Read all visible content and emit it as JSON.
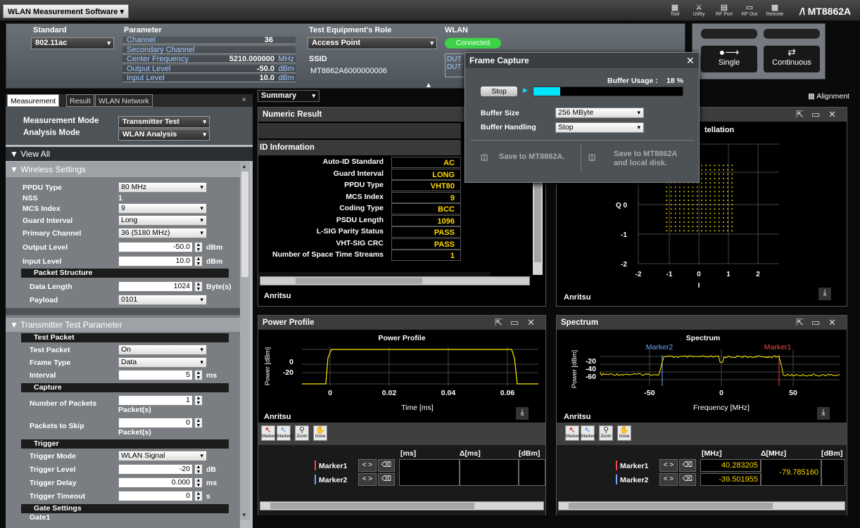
{
  "app": {
    "title": "WLAN Measurement Software",
    "toolbar": [
      {
        "label": "Tool",
        "icon": "tool-icon"
      },
      {
        "label": "Utility",
        "icon": "utility-icon"
      },
      {
        "label": "RF Port",
        "icon": "rf-port-icon"
      },
      {
        "label": "RF Out",
        "icon": "rf-out-icon"
      },
      {
        "label": "Remote",
        "icon": "remote-icon"
      }
    ],
    "brand": "MT8862A"
  },
  "params": {
    "standard_label": "Standard",
    "standard_value": "802.11ac",
    "parameter_label": "Parameter",
    "channel_label": "Channel",
    "channel_value": "36",
    "secondary_channel_label": "Secondary Channel",
    "center_freq_label": "Center Frequency",
    "center_freq_value": "5210.000000",
    "center_freq_unit": "MHz",
    "output_level_label": "Output Level",
    "output_level_value": "-50.0",
    "output_level_unit": "dBm",
    "input_level_label": "Input Level",
    "input_level_value": "10.0",
    "input_level_unit": "dBm",
    "role_label": "Test Equipment's Role",
    "role_value": "Access Point",
    "ssid_label": "SSID",
    "ssid_value": "MT8862A6000000006",
    "wlan_label": "WLAN",
    "wlan_status": "Connected",
    "dut_label_1": "DUT",
    "dut_label_2": "DUT"
  },
  "buttons": {
    "single": "Single",
    "continuous": "Continuous"
  },
  "alignment": "Alignment",
  "view_select": "Summary",
  "left_tabs": [
    {
      "label": "Measurement",
      "active": true
    },
    {
      "label": "Result",
      "active": false
    },
    {
      "label": "WLAN Network",
      "active": false
    }
  ],
  "measurement_mode_label": "Measurement Mode",
  "measurement_mode_value": "Transmitter Test",
  "analysis_mode_label": "Analysis Mode",
  "analysis_mode_value": "WLAN Analysis",
  "view_all": "View All",
  "wireless": {
    "title": "Wireless Settings",
    "ppdu_type_label": "PPDU Type",
    "ppdu_type_value": "80 MHz",
    "nss_label": "NSS",
    "nss_value": "1",
    "mcs_label": "MCS Index",
    "mcs_value": "9",
    "gi_label": "Guard Interval",
    "gi_value": "Long",
    "primary_label": "Primary Channel",
    "primary_value": "36 (5180 MHz)",
    "out_label": "Output Level",
    "out_value": "-50.0",
    "out_unit": "dBm",
    "in_label": "Input Level",
    "in_value": "10.0",
    "in_unit": "dBm",
    "packet_structure": "Packet Structure",
    "data_length_label": "Data Length",
    "data_length_value": "1024",
    "data_length_unit": "Byte(s)",
    "payload_label": "Payload",
    "payload_value": "0101"
  },
  "tx": {
    "title": "Transmitter Test Parameter",
    "test_packet_head": "Test Packet",
    "test_packet_label": "Test Packet",
    "test_packet_value": "On",
    "frame_type_label": "Frame Type",
    "frame_type_value": "Data",
    "interval_label": "Interval",
    "interval_value": "5",
    "interval_unit": "ms",
    "capture_head": "Capture",
    "num_packets_label": "Number of Packets",
    "num_packets_value": "1",
    "num_packets_unit": "Packet(s)",
    "skip_label": "Packets to Skip",
    "skip_value": "0",
    "skip_unit": "Packet(s)",
    "trigger_head": "Trigger",
    "trig_mode_label": "Trigger Mode",
    "trig_mode_value": "WLAN Signal",
    "trig_level_label": "Trigger Level",
    "trig_level_value": "-20",
    "trig_level_unit": "dB",
    "trig_delay_label": "Trigger Delay",
    "trig_delay_value": "0.000",
    "trig_delay_unit": "ms",
    "trig_timeout_label": "Trigger Timeout",
    "trig_timeout_value": "0",
    "trig_timeout_unit": "s",
    "gate_head": "Gate Settings",
    "gate1_label": "Gate1"
  },
  "numeric": {
    "title": "Numeric Result",
    "id_info": "ID Information",
    "rows": [
      {
        "k": "Auto-ID Standard",
        "v": "AC"
      },
      {
        "k": "Guard Interval",
        "v": "LONG"
      },
      {
        "k": "PPDU Type",
        "v": "VHT80"
      },
      {
        "k": "MCS Index",
        "v": "9"
      },
      {
        "k": "Coding Type",
        "v": "BCC"
      },
      {
        "k": "PSDU Length",
        "v": "1096"
      },
      {
        "k": "L-SIG Parity Status",
        "v": "PASS"
      },
      {
        "k": "VHT-SIG CRC",
        "v": "PASS"
      },
      {
        "k": "Number of Space Time Streams",
        "v": "1"
      }
    ]
  },
  "constellation": {
    "title_partial": "tellation",
    "y_axis_label": "Q",
    "x_axis_label": "I",
    "x_ticks": [
      "-2",
      "-1",
      "0",
      "1",
      "2"
    ],
    "y_ticks": [
      "0",
      "-1",
      "-2"
    ]
  },
  "power_profile": {
    "window_title": "Power Profile",
    "chart_title": "Power Profile",
    "ylabel": "Power [dBm]",
    "xlabel": "Time [ms]",
    "x_ticks": [
      "0",
      "0.02",
      "0.04",
      "0.06"
    ],
    "y_ticks": [
      "0",
      "-20"
    ]
  },
  "spectrum": {
    "window_title": "Spectrum",
    "chart_title": "Spectrum",
    "ylabel": "Power [dBm]",
    "xlabel": "Frequency [MHz]",
    "x_ticks": [
      "-50",
      "0",
      "50"
    ],
    "y_ticks": [
      "-20",
      "-40",
      "-60"
    ],
    "marker1_label": "Marker1",
    "marker2_label": "Marker2"
  },
  "brand_logo": "Anritsu",
  "marker_tools": [
    {
      "label": "Marker1"
    },
    {
      "label": "Marker2"
    },
    {
      "label": "Zoom"
    },
    {
      "label": "move"
    }
  ],
  "pp_markers": {
    "col1": "[ms]",
    "col2": "Δ[ms]",
    "col3": "[dBm]",
    "rows": [
      {
        "name": "Marker1",
        "v1": "",
        "v2": "",
        "v3": ""
      },
      {
        "name": "Marker2",
        "v1": "",
        "v2": "",
        "v3": ""
      }
    ]
  },
  "sp_markers": {
    "col1": "[MHz]",
    "col2": "Δ[MHz]",
    "col3": "[dBm]",
    "rows": [
      {
        "name": "Marker1",
        "v1": "40.283205"
      },
      {
        "name": "Marker2",
        "v1": "-39.501955"
      }
    ],
    "delta": "-79.785160"
  },
  "frame_capture": {
    "title": "Frame Capture",
    "buffer_usage_label": "Buffer Usage :",
    "buffer_usage_value": "18 %",
    "buffer_usage_fraction": 0.18,
    "stop_button": "Stop",
    "buffer_size_label": "Buffer Size",
    "buffer_size_value": "256 MByte",
    "buffer_handling_label": "Buffer Handling",
    "buffer_handling_value": "Stop",
    "save_mt": "Save to MT8862A.",
    "save_local_1": "Save to MT8862A",
    "save_local_2": "and local disk."
  },
  "colors": {
    "trace": "#ffee00",
    "marker1": "#ff4040",
    "marker2": "#6fa8ff",
    "connected": "#3ed14a",
    "progress": "#00e5ff"
  }
}
